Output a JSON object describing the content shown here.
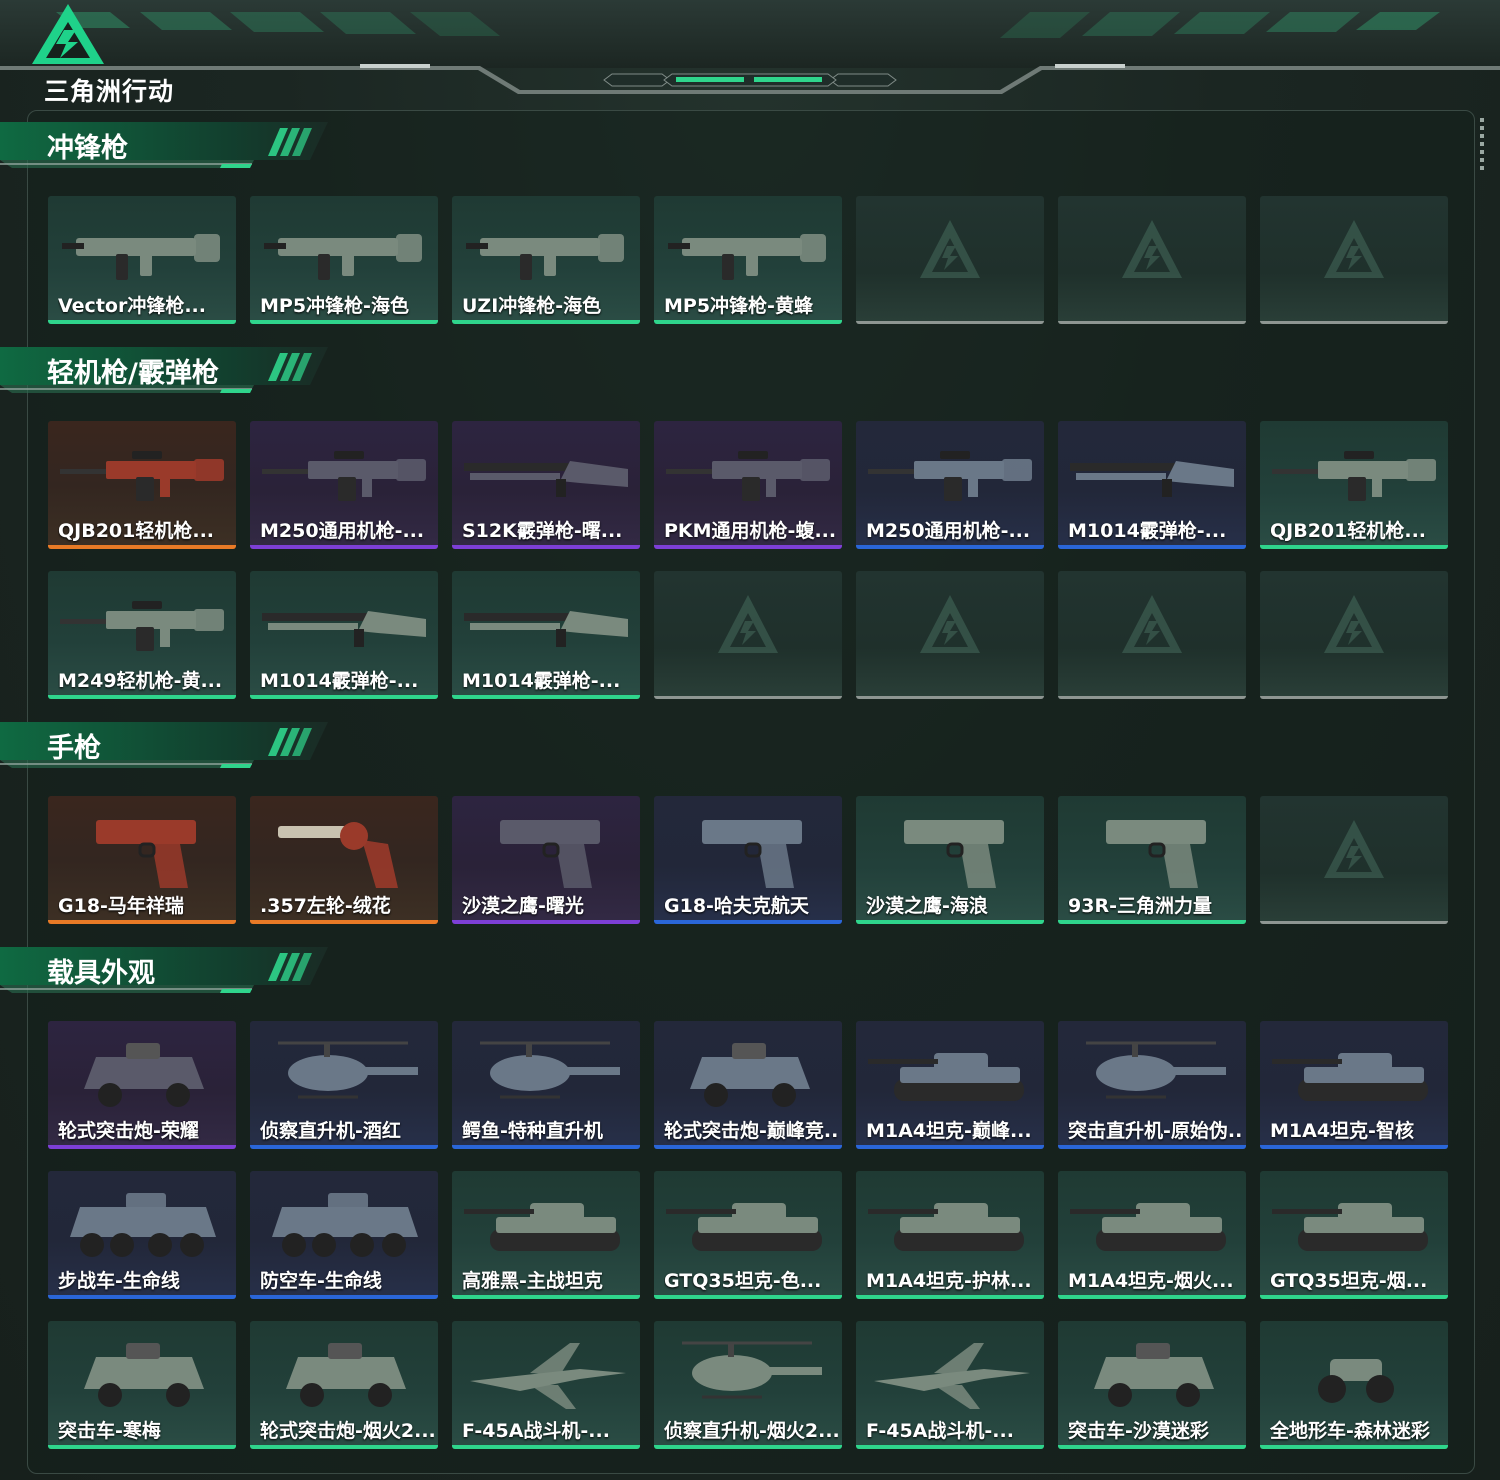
{
  "app": {
    "logo_text": "三角洲行动"
  },
  "colors": {
    "green": "#2fd58c",
    "orange": "#e87a26",
    "purple": "#7d3fd6",
    "blue": "#2a66d8",
    "empty": "#8e9692"
  },
  "sections": [
    {
      "title": "冲锋枪",
      "rows": [
        [
          {
            "name": "Vector冲锋枪...",
            "rarity": "green",
            "icon": "smg-icon"
          },
          {
            "name": "MP5冲锋枪-海色",
            "rarity": "green",
            "icon": "smg-icon"
          },
          {
            "name": "UZI冲锋枪-海色",
            "rarity": "green",
            "icon": "smg-icon"
          },
          {
            "name": "MP5冲锋枪-黄蜂",
            "rarity": "green",
            "icon": "smg-icon"
          },
          null,
          null,
          null
        ]
      ]
    },
    {
      "title": "轻机枪/霰弹枪",
      "rows": [
        [
          {
            "name": "QJB201轻机枪...",
            "rarity": "orange",
            "icon": "lmg-icon"
          },
          {
            "name": "M250通用机枪-...",
            "rarity": "purple",
            "icon": "lmg-icon"
          },
          {
            "name": "S12K霰弹枪-曙...",
            "rarity": "purple",
            "icon": "shotgun-icon"
          },
          {
            "name": "PKM通用机枪-蝮...",
            "rarity": "purple",
            "icon": "lmg-icon"
          },
          {
            "name": "M250通用机枪-...",
            "rarity": "blue",
            "icon": "lmg-icon"
          },
          {
            "name": "M1014霰弹枪-...",
            "rarity": "blue",
            "icon": "shotgun-icon"
          },
          {
            "name": "QJB201轻机枪...",
            "rarity": "green",
            "icon": "lmg-icon"
          }
        ],
        [
          {
            "name": "M249轻机枪-黄...",
            "rarity": "green",
            "icon": "lmg-icon"
          },
          {
            "name": "M1014霰弹枪-...",
            "rarity": "green",
            "icon": "shotgun-icon"
          },
          {
            "name": "M1014霰弹枪-...",
            "rarity": "green",
            "icon": "shotgun-icon"
          },
          null,
          null,
          null,
          null
        ]
      ]
    },
    {
      "title": "手枪",
      "rows": [
        [
          {
            "name": "G18-马年祥瑞",
            "rarity": "orange",
            "icon": "pistol-icon"
          },
          {
            "name": ".357左轮-绒花",
            "rarity": "orange",
            "icon": "revolver-icon"
          },
          {
            "name": "沙漠之鹰-曙光",
            "rarity": "purple",
            "icon": "pistol-icon"
          },
          {
            "name": "G18-哈夫克航天",
            "rarity": "blue",
            "icon": "pistol-icon"
          },
          {
            "name": "沙漠之鹰-海浪",
            "rarity": "green",
            "icon": "pistol-icon"
          },
          {
            "name": "93R-三角洲力量",
            "rarity": "green",
            "icon": "pistol-icon"
          },
          null
        ]
      ]
    },
    {
      "title": "载具外观",
      "rows": [
        [
          {
            "name": "轮式突击炮-荣耀",
            "rarity": "purple",
            "icon": "armored-car-icon"
          },
          {
            "name": "侦察直升机-酒红",
            "rarity": "blue",
            "icon": "helicopter-icon"
          },
          {
            "name": "鳄鱼-特种直升机",
            "rarity": "blue",
            "icon": "helicopter-icon"
          },
          {
            "name": "轮式突击炮-巅峰竞...",
            "rarity": "blue",
            "icon": "armored-car-icon"
          },
          {
            "name": "M1A4坦克-巅峰...",
            "rarity": "blue",
            "icon": "tank-icon"
          },
          {
            "name": "突击直升机-原始伪...",
            "rarity": "blue",
            "icon": "helicopter-icon"
          },
          {
            "name": "M1A4坦克-智核",
            "rarity": "blue",
            "icon": "tank-icon"
          }
        ],
        [
          {
            "name": "步战车-生命线",
            "rarity": "blue",
            "icon": "ifv-icon"
          },
          {
            "name": "防空车-生命线",
            "rarity": "blue",
            "icon": "ifv-icon"
          },
          {
            "name": "高雅黑-主战坦克",
            "rarity": "green",
            "icon": "tank-icon"
          },
          {
            "name": "GTQ35坦克-色...",
            "rarity": "green",
            "icon": "tank-icon"
          },
          {
            "name": "M1A4坦克-护林...",
            "rarity": "green",
            "icon": "tank-icon"
          },
          {
            "name": "M1A4坦克-烟火...",
            "rarity": "green",
            "icon": "tank-icon"
          },
          {
            "name": "GTQ35坦克-烟...",
            "rarity": "green",
            "icon": "tank-icon"
          }
        ],
        [
          {
            "name": "突击车-寒梅",
            "rarity": "green",
            "icon": "armored-car-icon"
          },
          {
            "name": "轮式突击炮-烟火2...",
            "rarity": "green",
            "icon": "armored-car-icon"
          },
          {
            "name": "F-45A战斗机-...",
            "rarity": "green",
            "icon": "jet-icon"
          },
          {
            "name": "侦察直升机-烟火2...",
            "rarity": "green",
            "icon": "helicopter-icon"
          },
          {
            "name": "F-45A战斗机-...",
            "rarity": "green",
            "icon": "jet-icon"
          },
          {
            "name": "突击车-沙漠迷彩",
            "rarity": "green",
            "icon": "armored-car-icon"
          },
          {
            "name": "全地形车-森林迷彩",
            "rarity": "green",
            "icon": "atv-icon"
          }
        ]
      ]
    }
  ]
}
